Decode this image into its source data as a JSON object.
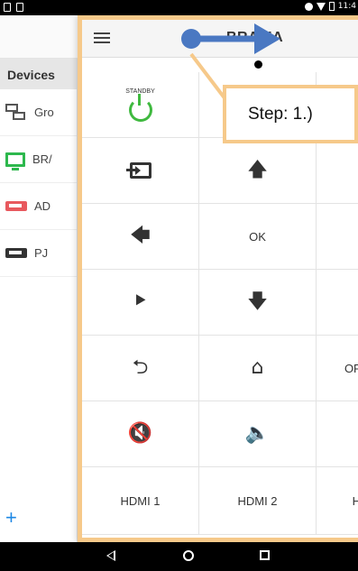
{
  "status_bar": {
    "time": "11:4"
  },
  "sidebar": {
    "header": "Devices",
    "items": [
      {
        "label": "Gro",
        "icon": "group-icon"
      },
      {
        "label": "BR/",
        "icon": "tv-icon"
      },
      {
        "label": "AD",
        "icon": "av-receiver-icon"
      },
      {
        "label": "PJ",
        "icon": "projector-icon"
      }
    ],
    "add_label": "+"
  },
  "remote": {
    "title": "BRAVIA",
    "standby_label": "STANDBY",
    "ok_label": "OK",
    "clipped_right_labels": {
      "home_row": "OF",
      "hdmi_row": "H"
    },
    "hdmi1_label": "HDMI 1",
    "hdmi2_label": "HDMI 2"
  },
  "tutorial": {
    "step_label": "Step: 1.)"
  },
  "colors": {
    "accent_blue": "#4a78c2",
    "highlight_orange": "#f6c98a",
    "power_green": "#3fb93f",
    "tv_green": "#2db84d",
    "av_red": "#e8595e"
  }
}
